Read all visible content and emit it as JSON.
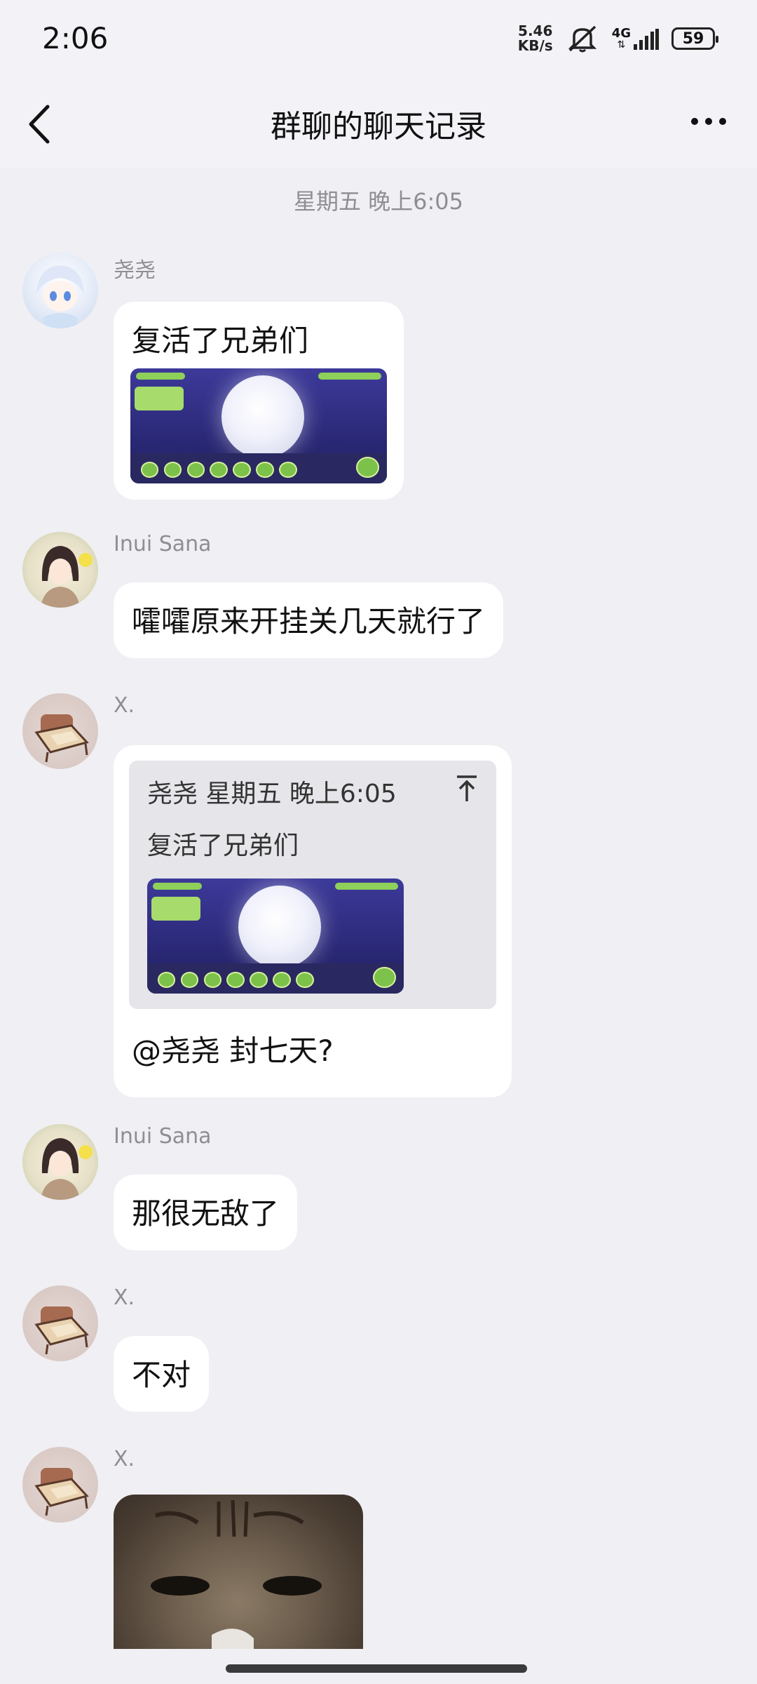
{
  "status_bar": {
    "time": "2:06",
    "net_speed_value": "5.46",
    "net_speed_unit": "KB/s",
    "network": "4G",
    "battery": "59"
  },
  "nav": {
    "title": "群聊的聊天记录",
    "back_icon": "chevron-left-icon",
    "more_icon": "more-horizontal-icon"
  },
  "chat": {
    "timestamp": "星期五 晚上6:05",
    "messages": [
      {
        "sender": "尧尧",
        "text": "复活了兄弟们",
        "has_image": true
      },
      {
        "sender": "Inui Sana",
        "text": "嚯嚯原来开挂关几天就行了"
      },
      {
        "sender": "X.",
        "quote": {
          "header": "尧尧  星期五 晚上6:05",
          "text": "复活了兄弟们",
          "has_image": true
        },
        "text": "@尧尧 封七天?"
      },
      {
        "sender": "Inui Sana",
        "text": "那很无敌了"
      },
      {
        "sender": "X.",
        "text": "不对"
      },
      {
        "sender": "X.",
        "image": "cat-photo"
      }
    ]
  }
}
